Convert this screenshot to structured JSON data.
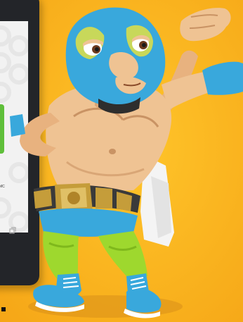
{
  "colors": {
    "background": "#f9b21b",
    "phone_body": "#232529",
    "screen": "#f2f2f2",
    "green_accent": "#5fbf3a",
    "mask": "#39a8dc",
    "mask_trim": "#c8d85a",
    "skin": "#efc393",
    "tights": "#9ed82e",
    "belt": "#c59d3a",
    "cape": "#f4f4f4"
  },
  "phone": {
    "brand_fragment": "d",
    "trademark": "MC",
    "nav_icon": "recent-apps-icon"
  },
  "mascot": {
    "icon": "luchador-wrestler-mascot"
  }
}
